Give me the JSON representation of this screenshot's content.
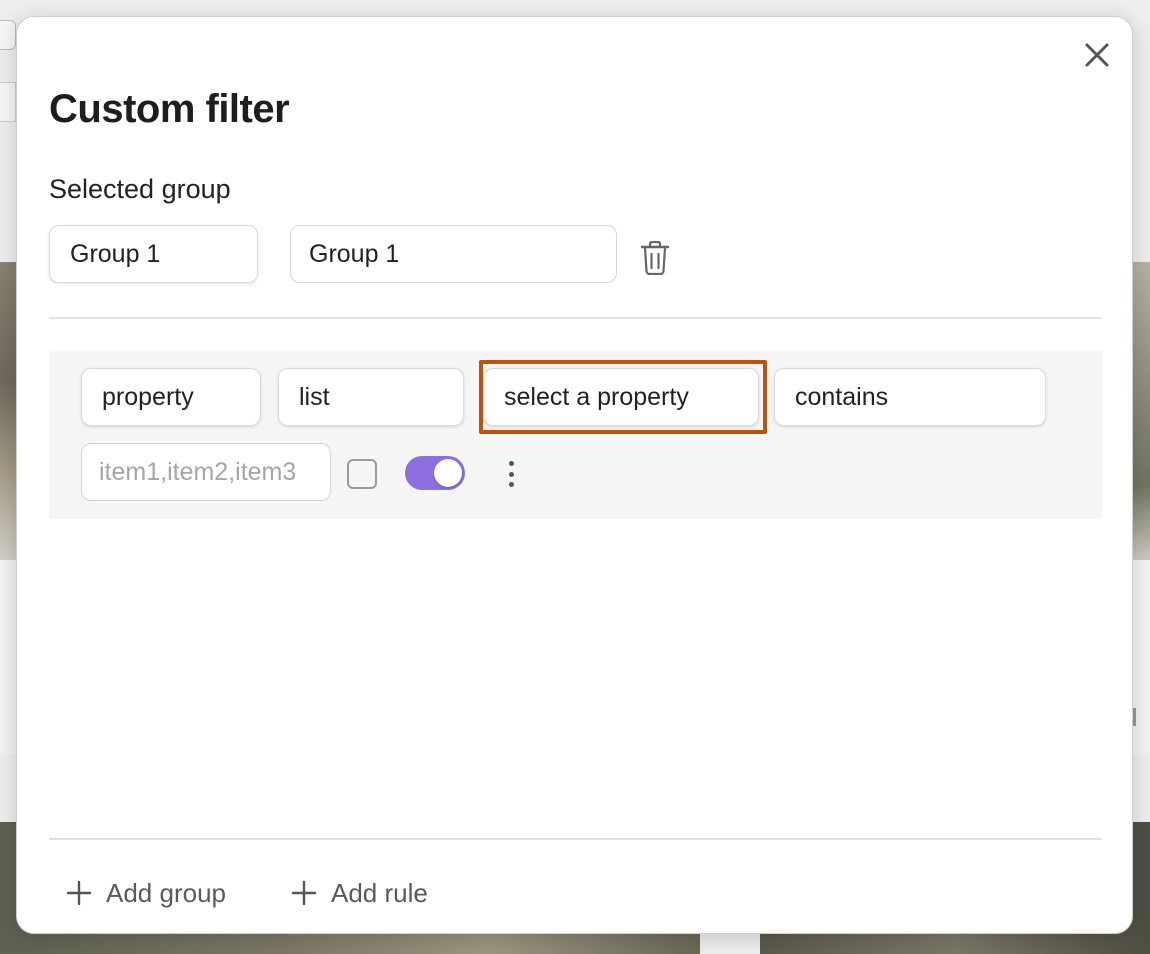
{
  "modal": {
    "title": "Custom filter",
    "close_icon": "close-icon",
    "section_label": "Selected group",
    "group_select_value": "Group 1",
    "group_name_value": "Group 1",
    "delete_icon": "trash-icon"
  },
  "rule": {
    "type_value": "property",
    "kind_value": "list",
    "property_value": "select a property",
    "operator_value": "contains",
    "value_placeholder": "item1,item2,item3",
    "checkbox_checked": false,
    "toggle_on": true,
    "more_icon": "vertical-ellipsis-icon"
  },
  "footer": {
    "add_group_label": "Add group",
    "add_rule_label": "Add rule",
    "plus_icon": "plus-icon"
  },
  "colors": {
    "focus_outline": "#bd520f",
    "toggle_on": "#8d6fe0",
    "link_accent": "#8c76d8"
  }
}
